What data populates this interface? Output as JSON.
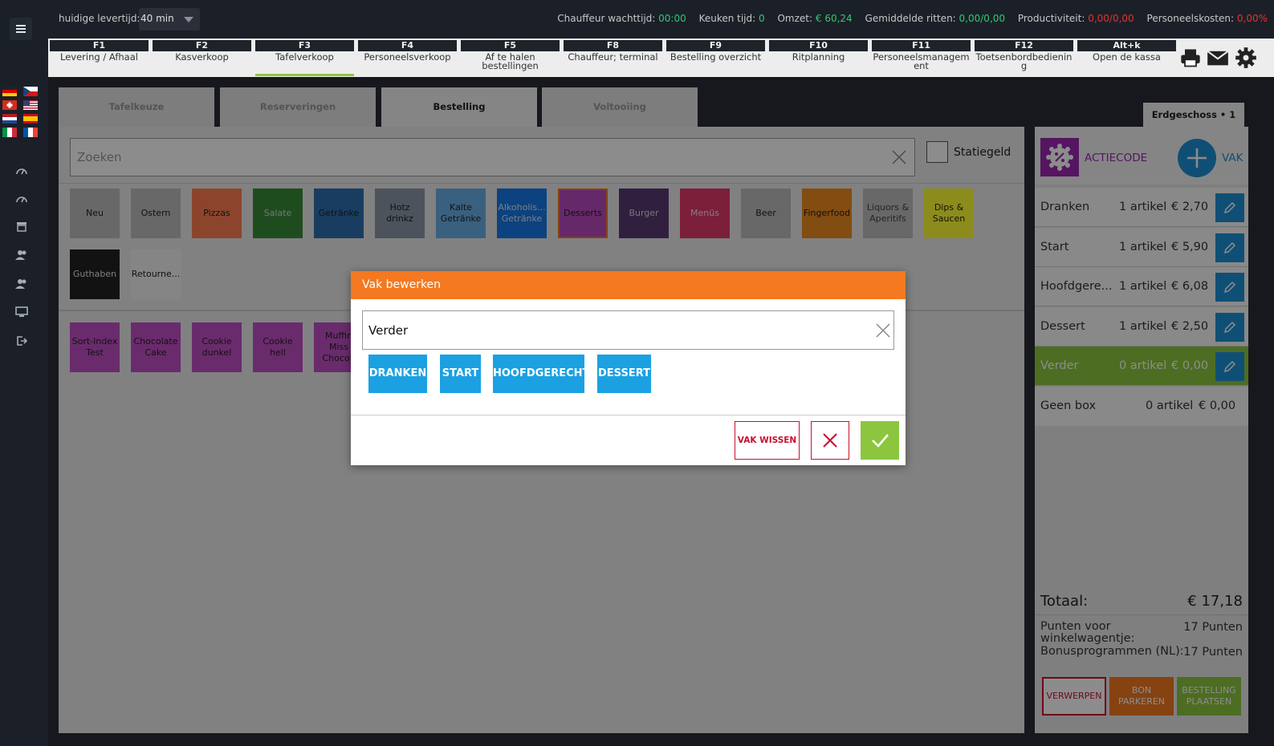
{
  "topbar": {
    "lead_label": "huidige levertijd:",
    "lead_value": "40 min",
    "stats": [
      {
        "label": "Chauffeur wachttijd:",
        "value": "00:00",
        "color": "#2ecc71"
      },
      {
        "label": "Keuken tijd:",
        "value": "0",
        "color": "#2ecc71"
      },
      {
        "label": "Omzet:",
        "value": "€ 60,24",
        "color": "#2ecc71"
      },
      {
        "label": "Gemiddelde ritten:",
        "value": "0,00/0,00",
        "color": "#2ecc71"
      },
      {
        "label": "Productiviteit:",
        "value": "0,00/0,00",
        "color": "#e3342f"
      },
      {
        "label": "Personeelskosten:",
        "value": "0,00%",
        "color": "#e3342f"
      }
    ]
  },
  "fkeys": [
    {
      "key": "F1",
      "label": "Levering / Afhaal"
    },
    {
      "key": "F2",
      "label": "Kasverkoop"
    },
    {
      "key": "F3",
      "label": "Tafelverkoop"
    },
    {
      "key": "F4",
      "label": "Personeelsverkoop"
    },
    {
      "key": "F5",
      "label": "Af te halen bestellingen"
    },
    {
      "key": "F8",
      "label": "Chauffeur; terminal"
    },
    {
      "key": "F9",
      "label": "Bestelling overzicht"
    },
    {
      "key": "F10",
      "label": "Ritplanning"
    },
    {
      "key": "F11",
      "label": "Personeelsmanagem ent"
    },
    {
      "key": "F12",
      "label": "Toetsenbordbedienin g"
    },
    {
      "key": "Alt+k",
      "label": "Open de kassa"
    }
  ],
  "tabs": [
    "Tafelkeuze",
    "Reserveringen",
    "Bestelling",
    "Voltooiing"
  ],
  "search": {
    "placeholder": "Zoeken",
    "deposit_label": "Statiegeld"
  },
  "categories": [
    {
      "label": "Neu",
      "bg": "#bdbdbd",
      "fg": "#222"
    },
    {
      "label": "Ostern",
      "bg": "#bdbdbd",
      "fg": "#222"
    },
    {
      "label": "Pizzas",
      "bg": "#ff7f50",
      "fg": "#222"
    },
    {
      "label": "Salate",
      "bg": "#3a8a3a",
      "fg": "#d8d8d8"
    },
    {
      "label": "Getränke",
      "bg": "#2f6fb0",
      "fg": "#222"
    },
    {
      "label": "Hotz\ndrinkz",
      "bg": "#8a98a8",
      "fg": "#222"
    },
    {
      "label": "Kalte\nGetränke",
      "bg": "#6ab0e8",
      "fg": "#222"
    },
    {
      "label": "Alkoholis...\nGetränke",
      "bg": "#1479e8",
      "fg": "#e8e8e8"
    },
    {
      "label": "Desserts",
      "bg": "#b84cc0",
      "fg": "#222"
    },
    {
      "label": "Burger",
      "bg": "#5a3a74",
      "fg": "#d8d8d8"
    },
    {
      "label": "Menüs",
      "bg": "#e03a6a",
      "fg": "#e8e8e8"
    },
    {
      "label": "Beer",
      "bg": "#bdbdbd",
      "fg": "#222"
    },
    {
      "label": "Fingerfood",
      "bg": "#ee8a20",
      "fg": "#222"
    },
    {
      "label": "Liquors &\nAperitifs",
      "bg": "#bdbdbd",
      "fg": "#444"
    },
    {
      "label": "Dips &\nSaucen",
      "bg": "#ffff33",
      "fg": "#222"
    },
    {
      "label": "Guthaben",
      "bg": "#222222",
      "fg": "#e8e8e8"
    },
    {
      "label": "Retourne...",
      "bg": "#f2f2f2",
      "fg": "#222"
    }
  ],
  "products": [
    {
      "label": "Sort-Index\nTest",
      "bg": "#c14fc6",
      "fg": "#222"
    },
    {
      "label": "Chocolate\nCake",
      "bg": "#c14fc6",
      "fg": "#222"
    },
    {
      "label": "Cookie\ndunkel",
      "bg": "#c14fc6",
      "fg": "#222"
    },
    {
      "label": "Cookie\nhell",
      "bg": "#c14fc6",
      "fg": "#222"
    },
    {
      "label": "Muffin\nMiss\nChocoh",
      "bg": "#c14fc6",
      "fg": "#222"
    }
  ],
  "right": {
    "floor_tab": "Erdgeschoss • 1",
    "promo_label": "ACTIECODE",
    "vak_label": "VAK",
    "courses": [
      {
        "name": "Dranken",
        "count": "1 artikel",
        "price": "€ 2,70"
      },
      {
        "name": "Start",
        "count": "1 artikel",
        "price": "€ 5,90"
      },
      {
        "name": "Hoofdgere...",
        "count": "1 artikel",
        "price": "€ 6,08"
      },
      {
        "name": "Dessert",
        "count": "1 artikel",
        "price": "€ 2,50"
      },
      {
        "name": "Verder",
        "count": "0 artikel",
        "price": "€ 0,00"
      },
      {
        "name": "Geen box",
        "count": "0 artikel",
        "price": "€ 0,00"
      }
    ],
    "total_label": "Totaal:",
    "total_value": "€ 17,18",
    "points_cart_label": "Punten voor winkelwagentje:",
    "points_cart_value": "17 Punten",
    "points_bonus_label": "Bonusprogrammen (NL):",
    "points_bonus_value": "17 Punten",
    "btn_discard": "VERWERPEN",
    "btn_park": "BON PARKEREN",
    "btn_order": "BESTELLING PLAATSEN"
  },
  "modal": {
    "title": "Vak bewerken",
    "value": "Verder",
    "chips": [
      "DRANKEN",
      "START",
      "HOOFDGERECHT",
      "DESSERT"
    ],
    "clear_label": "VAK WISSEN"
  }
}
